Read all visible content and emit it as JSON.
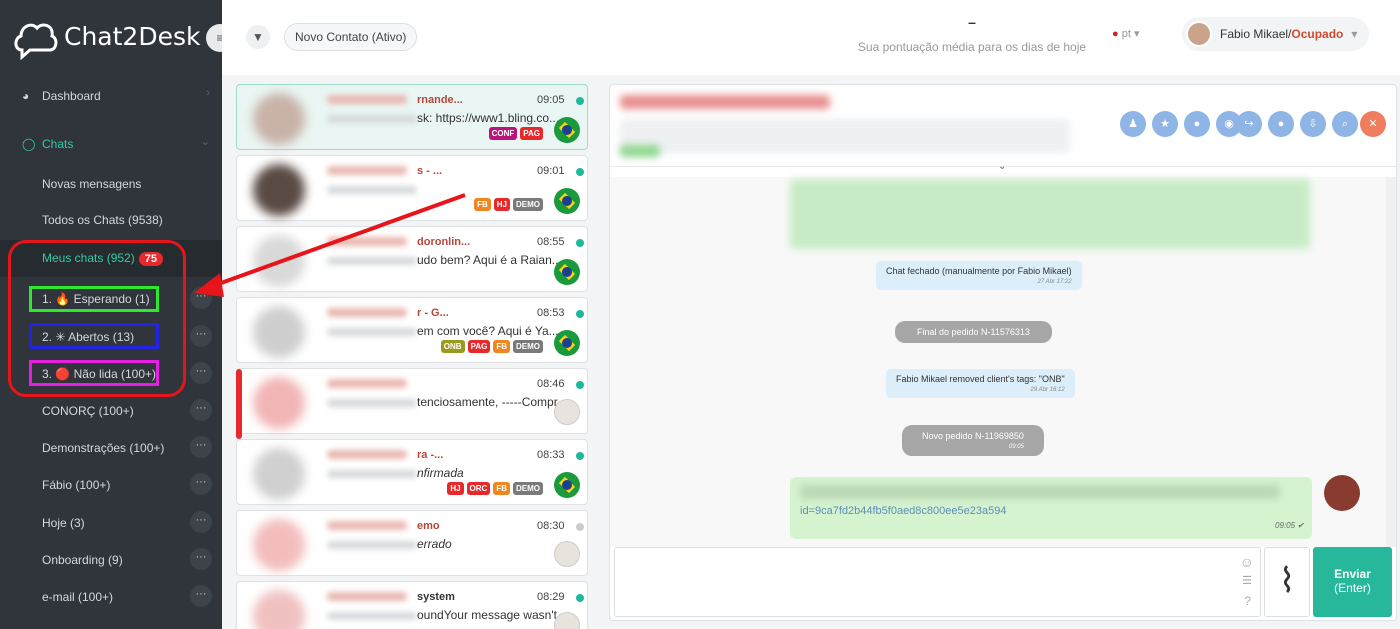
{
  "brand": {
    "name": "Chat2Desk"
  },
  "sidebar": {
    "dashboard": "Dashboard",
    "chats": "Chats",
    "items": [
      {
        "label": "Novas mensagens"
      },
      {
        "label": "Todos os Chats (9538)"
      },
      {
        "label": "Meus chats (952)",
        "badge": "75"
      },
      {
        "label": "1. 🔥 Esperando (1)"
      },
      {
        "label": "2. ✳ Abertos (13)"
      },
      {
        "label": "3. 🔴 Não lida (100+)"
      },
      {
        "label": "CONORÇ (100+)"
      },
      {
        "label": "Demonstrações (100+)"
      },
      {
        "label": "Fábio (100+)"
      },
      {
        "label": "Hoje (3)"
      },
      {
        "label": "Onboarding (9)"
      },
      {
        "label": "e-mail (100+)"
      }
    ],
    "dots": "···"
  },
  "header": {
    "filter": "Novo Contato (Ativo)",
    "score_value": "–",
    "score_label": "Sua pontuação média para os dias de hoje",
    "lang": "pt",
    "user_name": "Fabio Mikael",
    "user_sep": " / ",
    "user_status": "Ocupado"
  },
  "chats": [
    {
      "name": "rnande...",
      "preview": "sk: https://www1.bling.co...",
      "time": "09:05",
      "tags": [
        "CONF",
        "PAG"
      ],
      "end": "flag"
    },
    {
      "name": "s - ...",
      "preview": "",
      "time": "09:01",
      "tags": [
        "FB",
        "HJ",
        "DEMO"
      ],
      "end": "flag"
    },
    {
      "name": "doronlin...",
      "preview": "udo bem? Aqui é a Raian...",
      "time": "08:55",
      "tags": [],
      "end": "flag"
    },
    {
      "name": "r - G...",
      "preview": "em com você? Aqui é Ya...",
      "time": "08:53",
      "tags": [
        "ONB",
        "PAG",
        "FB",
        "DEMO"
      ],
      "end": "flag"
    },
    {
      "name": "",
      "preview": "tenciosamente, -----Compr...",
      "time": "08:46",
      "tags": [],
      "end": "face"
    },
    {
      "name": "ra -...",
      "preview": "nfirmada",
      "time": "08:33",
      "tags": [
        "HJ",
        "ORC",
        "FB",
        "DEMO"
      ],
      "end": "flag"
    },
    {
      "name": "emo",
      "preview": "errado",
      "time": "08:30",
      "tags": [],
      "end": "face"
    },
    {
      "name": "system",
      "preview": "oundYour message wasn't...",
      "time": "08:29",
      "tags": [],
      "end": "face"
    }
  ],
  "tag_colors": {
    "CONF": "#b8157a",
    "PAG": "#e7292c",
    "FB": "#f0861f",
    "HJ": "#e7292c",
    "DEMO": "#7a7a7a",
    "ONB": "#9a9a1e",
    "ORC": "#e7292c"
  },
  "messages": {
    "m1": "Chat fechado (manualmente por Fabio Mikael)",
    "m1_ts": "27 Abr 17:22",
    "m2": "Final do pedido N-11576313",
    "m3": "Fabio Mikael removed client's tags: \"ONB\"",
    "m3_ts": "29 Abr 16:12",
    "m4": "Novo pedido N-11969850",
    "m4_ts": "09:05",
    "m5": "id=9ca7fd2b44fb5f0aed8c800ee5e23a594",
    "m5_ts": "09:05 ✔"
  },
  "composer": {
    "send": "Enviar",
    "send_hint": "(Enter)"
  }
}
